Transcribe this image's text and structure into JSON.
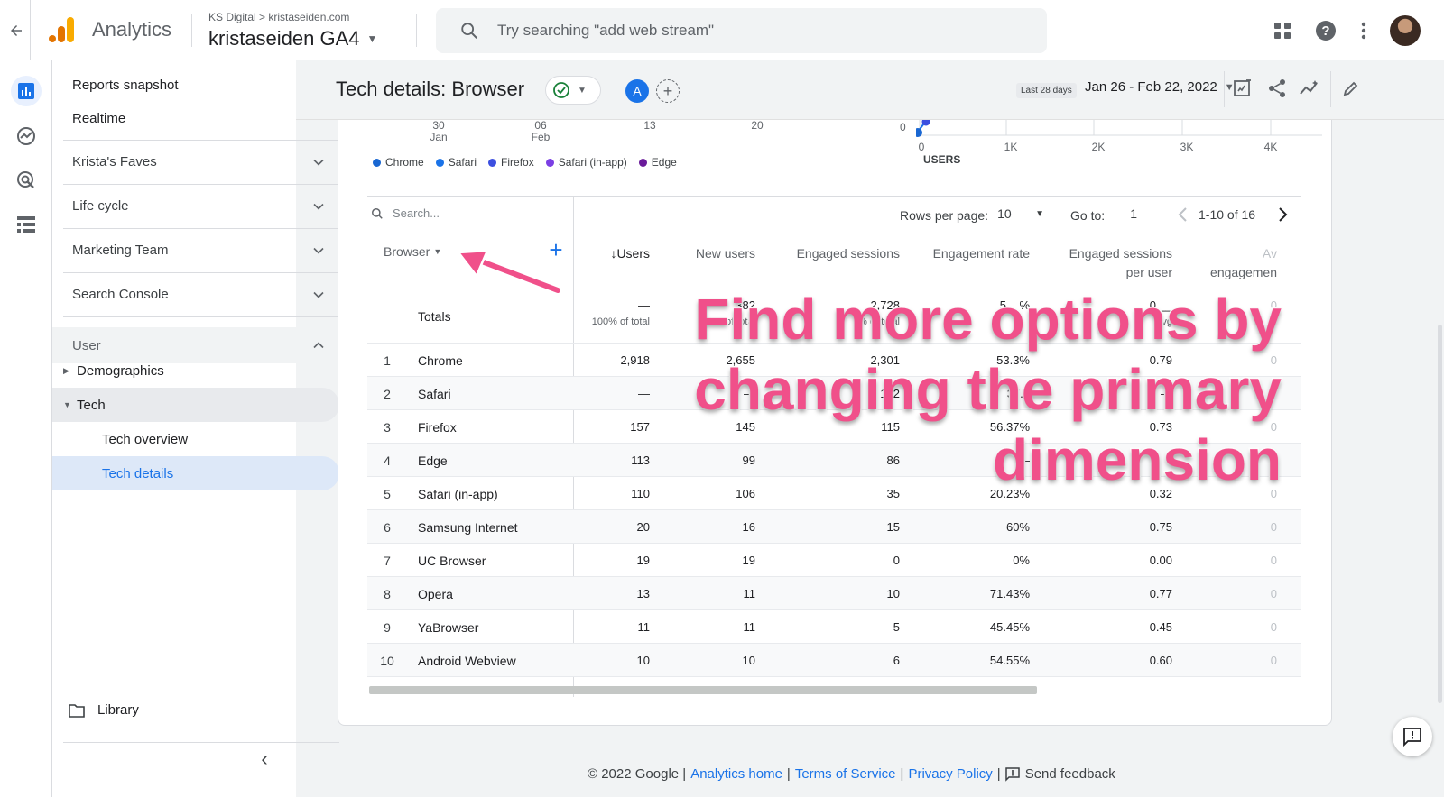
{
  "topbar": {
    "app_name": "Analytics",
    "account_path": "KS Digital > kristaseiden.com",
    "property_name": "kristaseiden GA4",
    "search_placeholder": "Try searching \"add web stream\""
  },
  "nav": {
    "reports_snapshot": "Reports snapshot",
    "realtime": "Realtime",
    "sections": [
      "Krista's Faves",
      "Life cycle",
      "Marketing Team",
      "Search Console"
    ],
    "user": "User",
    "demographics": "Demographics",
    "tech": "Tech",
    "tech_overview": "Tech overview",
    "tech_details": "Tech details",
    "library": "Library"
  },
  "report": {
    "title": "Tech details: Browser",
    "comparison_badge": "A",
    "date_label": "Last 28 days",
    "date_range": "Jan 26 - Feb 22, 2022"
  },
  "chart": {
    "x_ticks": [
      {
        "top": "30",
        "bottom": "Jan"
      },
      {
        "top": "06",
        "bottom": "Feb"
      },
      {
        "top": "13",
        "bottom": ""
      },
      {
        "top": "20",
        "bottom": ""
      }
    ],
    "scatter_y_tick": "0",
    "scatter_x_ticks": [
      "0",
      "1K",
      "2K",
      "3K",
      "4K"
    ],
    "scatter_x_label": "USERS",
    "legend": [
      {
        "name": "Chrome",
        "color": "#1967d2"
      },
      {
        "name": "Safari",
        "color": "#1a73e8"
      },
      {
        "name": "Firefox",
        "color": "#3c4fe0"
      },
      {
        "name": "Safari (in-app)",
        "color": "#7b3fe4"
      },
      {
        "name": "Edge",
        "color": "#6a1b9a"
      }
    ]
  },
  "table": {
    "search_placeholder": "Search...",
    "rows_per_page_label": "Rows per page:",
    "rows_per_page": "10",
    "goto_label": "Go to:",
    "goto_value": "1",
    "pager_text": "1-10 of 16",
    "dimension": "Browser",
    "columns": {
      "users": "Users",
      "new_users": "New users",
      "engaged_sessions": "Engaged sessions",
      "engagement_rate": "Engagement rate",
      "esp_user_1": "Engaged sessions",
      "esp_user_2": "per user",
      "avg_1": "Av",
      "avg_2": "engagemen"
    },
    "totals": {
      "label": "Totals",
      "users": "—",
      "users_sub": "100% of total",
      "new_users": "382",
      "new_users_sub": "% of total",
      "engaged_sessions": "2,728",
      "engaged_sessions_sub": "% of total",
      "engagement_rate": "5__%",
      "esp_user": "0.__",
      "esp_user_sub": "Avg",
      "avg": "0"
    },
    "rows": [
      {
        "idx": "1",
        "name": "Chrome",
        "users": "2,918",
        "new_users": "2,655",
        "engaged": "2,301",
        "rate": "53.3%",
        "esp": "0.79",
        "avg": "0"
      },
      {
        "idx": "2",
        "name": "Safari",
        "users": "—",
        "new_users": "—",
        "engaged": "152",
        "rate": "37.9",
        "esp": "—",
        "avg": "0"
      },
      {
        "idx": "3",
        "name": "Firefox",
        "users": "157",
        "new_users": "145",
        "engaged": "115",
        "rate": "56.37%",
        "esp": "0.73",
        "avg": "0"
      },
      {
        "idx": "4",
        "name": "Edge",
        "users": "113",
        "new_users": "99",
        "engaged": "86",
        "rate": "—",
        "esp": "6",
        "avg": "0"
      },
      {
        "idx": "5",
        "name": "Safari (in-app)",
        "users": "110",
        "new_users": "106",
        "engaged": "35",
        "rate": "20.23%",
        "esp": "0.32",
        "avg": "0"
      },
      {
        "idx": "6",
        "name": "Samsung Internet",
        "users": "20",
        "new_users": "16",
        "engaged": "15",
        "rate": "60%",
        "esp": "0.75",
        "avg": "0"
      },
      {
        "idx": "7",
        "name": "UC Browser",
        "users": "19",
        "new_users": "19",
        "engaged": "0",
        "rate": "0%",
        "esp": "0.00",
        "avg": "0"
      },
      {
        "idx": "8",
        "name": "Opera",
        "users": "13",
        "new_users": "11",
        "engaged": "10",
        "rate": "71.43%",
        "esp": "0.77",
        "avg": "0"
      },
      {
        "idx": "9",
        "name": "YaBrowser",
        "users": "11",
        "new_users": "11",
        "engaged": "5",
        "rate": "45.45%",
        "esp": "0.45",
        "avg": "0"
      },
      {
        "idx": "10",
        "name": "Android Webview",
        "users": "10",
        "new_users": "10",
        "engaged": "6",
        "rate": "54.55%",
        "esp": "0.60",
        "avg": "0"
      }
    ]
  },
  "annotation": {
    "line1": "Find more options by",
    "line2": "changing the primary",
    "line3": "dimension",
    "color": "#f0508a"
  },
  "footer": {
    "copyright": "© 2022 Google |",
    "analytics_home": "Analytics home",
    "sep1": "|",
    "terms": "Terms of Service",
    "sep2": "|",
    "privacy": "Privacy Policy",
    "sep3": "|",
    "feedback": "Send feedback"
  },
  "colors": {
    "accent": "#1a73e8",
    "logo_orange": "#f9ab00",
    "logo_dark_orange": "#e37400"
  }
}
